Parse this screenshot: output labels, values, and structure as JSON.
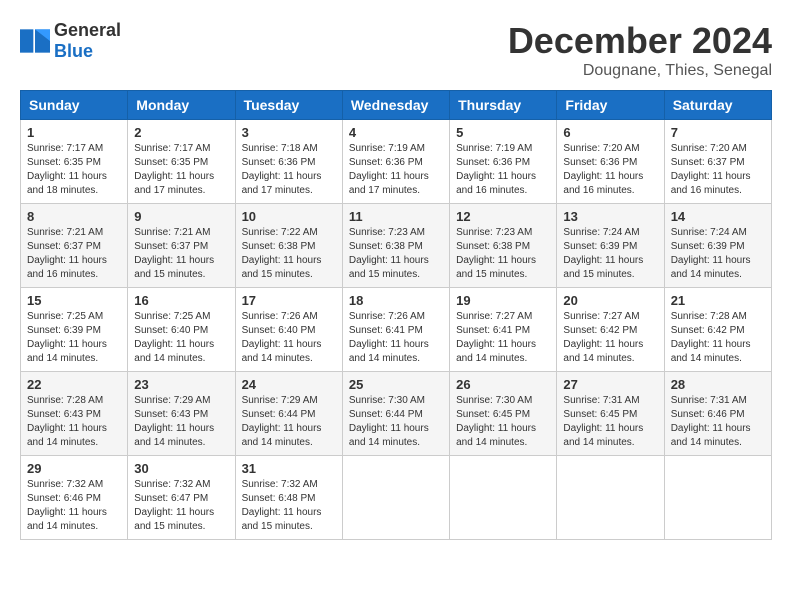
{
  "header": {
    "logo_general": "General",
    "logo_blue": "Blue",
    "month_title": "December 2024",
    "location": "Dougnane, Thies, Senegal"
  },
  "weekdays": [
    "Sunday",
    "Monday",
    "Tuesday",
    "Wednesday",
    "Thursday",
    "Friday",
    "Saturday"
  ],
  "weeks": [
    [
      {
        "day": "1",
        "sunrise": "7:17 AM",
        "sunset": "6:35 PM",
        "daylight": "11 hours and 18 minutes."
      },
      {
        "day": "2",
        "sunrise": "7:17 AM",
        "sunset": "6:35 PM",
        "daylight": "11 hours and 17 minutes."
      },
      {
        "day": "3",
        "sunrise": "7:18 AM",
        "sunset": "6:36 PM",
        "daylight": "11 hours and 17 minutes."
      },
      {
        "day": "4",
        "sunrise": "7:19 AM",
        "sunset": "6:36 PM",
        "daylight": "11 hours and 17 minutes."
      },
      {
        "day": "5",
        "sunrise": "7:19 AM",
        "sunset": "6:36 PM",
        "daylight": "11 hours and 16 minutes."
      },
      {
        "day": "6",
        "sunrise": "7:20 AM",
        "sunset": "6:36 PM",
        "daylight": "11 hours and 16 minutes."
      },
      {
        "day": "7",
        "sunrise": "7:20 AM",
        "sunset": "6:37 PM",
        "daylight": "11 hours and 16 minutes."
      }
    ],
    [
      {
        "day": "8",
        "sunrise": "7:21 AM",
        "sunset": "6:37 PM",
        "daylight": "11 hours and 16 minutes."
      },
      {
        "day": "9",
        "sunrise": "7:21 AM",
        "sunset": "6:37 PM",
        "daylight": "11 hours and 15 minutes."
      },
      {
        "day": "10",
        "sunrise": "7:22 AM",
        "sunset": "6:38 PM",
        "daylight": "11 hours and 15 minutes."
      },
      {
        "day": "11",
        "sunrise": "7:23 AM",
        "sunset": "6:38 PM",
        "daylight": "11 hours and 15 minutes."
      },
      {
        "day": "12",
        "sunrise": "7:23 AM",
        "sunset": "6:38 PM",
        "daylight": "11 hours and 15 minutes."
      },
      {
        "day": "13",
        "sunrise": "7:24 AM",
        "sunset": "6:39 PM",
        "daylight": "11 hours and 15 minutes."
      },
      {
        "day": "14",
        "sunrise": "7:24 AM",
        "sunset": "6:39 PM",
        "daylight": "11 hours and 14 minutes."
      }
    ],
    [
      {
        "day": "15",
        "sunrise": "7:25 AM",
        "sunset": "6:39 PM",
        "daylight": "11 hours and 14 minutes."
      },
      {
        "day": "16",
        "sunrise": "7:25 AM",
        "sunset": "6:40 PM",
        "daylight": "11 hours and 14 minutes."
      },
      {
        "day": "17",
        "sunrise": "7:26 AM",
        "sunset": "6:40 PM",
        "daylight": "11 hours and 14 minutes."
      },
      {
        "day": "18",
        "sunrise": "7:26 AM",
        "sunset": "6:41 PM",
        "daylight": "11 hours and 14 minutes."
      },
      {
        "day": "19",
        "sunrise": "7:27 AM",
        "sunset": "6:41 PM",
        "daylight": "11 hours and 14 minutes."
      },
      {
        "day": "20",
        "sunrise": "7:27 AM",
        "sunset": "6:42 PM",
        "daylight": "11 hours and 14 minutes."
      },
      {
        "day": "21",
        "sunrise": "7:28 AM",
        "sunset": "6:42 PM",
        "daylight": "11 hours and 14 minutes."
      }
    ],
    [
      {
        "day": "22",
        "sunrise": "7:28 AM",
        "sunset": "6:43 PM",
        "daylight": "11 hours and 14 minutes."
      },
      {
        "day": "23",
        "sunrise": "7:29 AM",
        "sunset": "6:43 PM",
        "daylight": "11 hours and 14 minutes."
      },
      {
        "day": "24",
        "sunrise": "7:29 AM",
        "sunset": "6:44 PM",
        "daylight": "11 hours and 14 minutes."
      },
      {
        "day": "25",
        "sunrise": "7:30 AM",
        "sunset": "6:44 PM",
        "daylight": "11 hours and 14 minutes."
      },
      {
        "day": "26",
        "sunrise": "7:30 AM",
        "sunset": "6:45 PM",
        "daylight": "11 hours and 14 minutes."
      },
      {
        "day": "27",
        "sunrise": "7:31 AM",
        "sunset": "6:45 PM",
        "daylight": "11 hours and 14 minutes."
      },
      {
        "day": "28",
        "sunrise": "7:31 AM",
        "sunset": "6:46 PM",
        "daylight": "11 hours and 14 minutes."
      }
    ],
    [
      {
        "day": "29",
        "sunrise": "7:32 AM",
        "sunset": "6:46 PM",
        "daylight": "11 hours and 14 minutes."
      },
      {
        "day": "30",
        "sunrise": "7:32 AM",
        "sunset": "6:47 PM",
        "daylight": "11 hours and 15 minutes."
      },
      {
        "day": "31",
        "sunrise": "7:32 AM",
        "sunset": "6:48 PM",
        "daylight": "11 hours and 15 minutes."
      },
      null,
      null,
      null,
      null
    ]
  ],
  "labels": {
    "sunrise": "Sunrise:",
    "sunset": "Sunset:",
    "daylight": "Daylight:"
  }
}
